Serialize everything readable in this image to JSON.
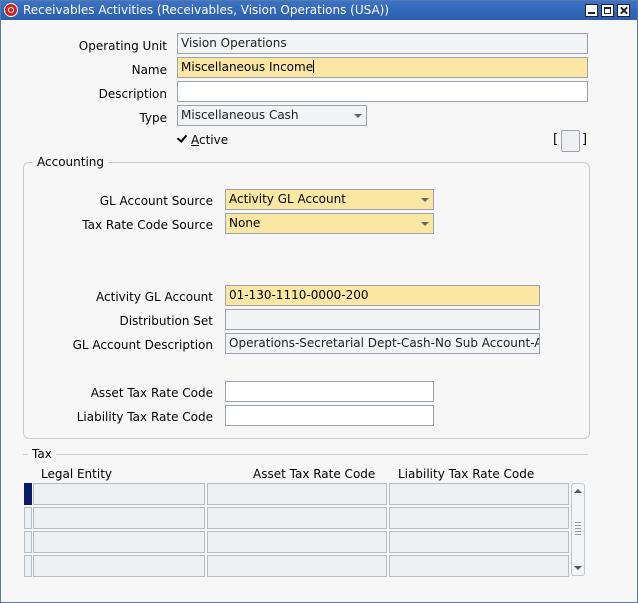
{
  "window": {
    "title": "Receivables Activities (Receivables, Vision Operations (USA))"
  },
  "form": {
    "operating_unit": {
      "label": "Operating Unit",
      "value": "Vision Operations"
    },
    "name": {
      "label": "Name",
      "value": "Miscellaneous Income"
    },
    "description": {
      "label": "Description",
      "value": ""
    },
    "type": {
      "label": "Type",
      "value": "Miscellaneous Cash"
    },
    "active": {
      "label_prefix": "",
      "label_underlined": "A",
      "label_rest": "ctive",
      "checked": true
    },
    "flex_open": "[",
    "flex_close": "]"
  },
  "accounting": {
    "title": "Accounting",
    "gl_account_source": {
      "label": "GL Account Source",
      "value": "Activity GL Account"
    },
    "tax_rate_code_source": {
      "label": "Tax Rate Code Source",
      "value": "None"
    },
    "activity_gl_account": {
      "label": "Activity GL Account",
      "value": "01-130-1110-0000-200"
    },
    "distribution_set": {
      "label": "Distribution Set",
      "value": ""
    },
    "gl_account_description": {
      "label": "GL Account Description",
      "value": "Operations-Secretarial Dept-Cash-No Sub Account-Ac"
    },
    "asset_tax_rate_code": {
      "label": "Asset Tax Rate Code",
      "value": ""
    },
    "liability_tax_rate_code": {
      "label": "Liability Tax Rate Code",
      "value": ""
    }
  },
  "tax": {
    "title": "Tax",
    "columns": [
      "Legal Entity",
      "Asset Tax Rate Code",
      "Liability Tax Rate Code"
    ],
    "rows": [
      [
        "",
        "",
        ""
      ],
      [
        "",
        "",
        ""
      ],
      [
        "",
        "",
        ""
      ],
      [
        "",
        "",
        ""
      ]
    ]
  },
  "colors": {
    "required_field": "#fbe7a3",
    "titlebar": "#2a5db0",
    "current_row": "#0a1a6a"
  },
  "icons": {
    "app": "oracle-icon",
    "minimize": "minimize-icon",
    "maximize": "maximize-icon",
    "close": "close-icon",
    "check": "check-icon"
  }
}
